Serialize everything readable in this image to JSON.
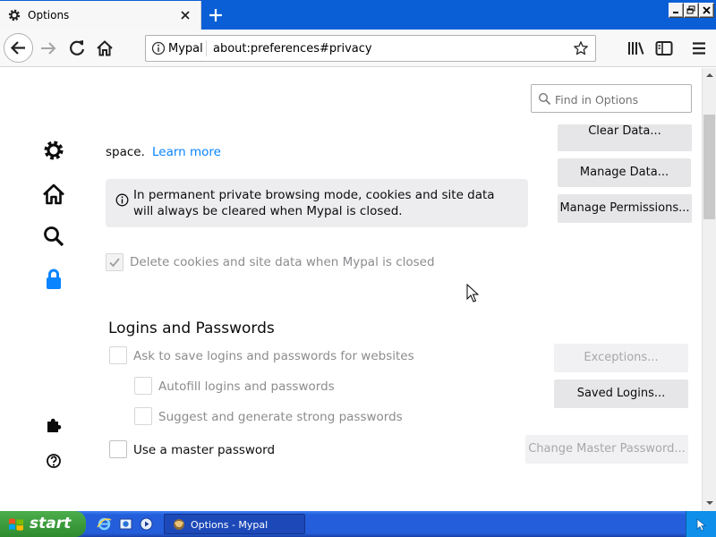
{
  "window": {
    "tab_title": "Options",
    "colors": {
      "titlebar": "#0a5fd6",
      "accent_link": "#0a84ff",
      "taskbar": "#245edb",
      "start_button": "#3c9c3c"
    }
  },
  "urlbar": {
    "identity_label": "Mypal",
    "url": "about:preferences#privacy"
  },
  "search": {
    "placeholder": "Find in Options"
  },
  "sidebar": {
    "categories": [
      {
        "icon": "gear-icon",
        "name": "General"
      },
      {
        "icon": "home-icon",
        "name": "Home"
      },
      {
        "icon": "search-icon",
        "name": "Search"
      },
      {
        "icon": "lock-icon",
        "name": "Privacy & Security",
        "selected": true
      }
    ],
    "footer": [
      {
        "icon": "puzzle-icon"
      },
      {
        "icon": "help-icon"
      }
    ]
  },
  "cookies": {
    "text_tail": "space.",
    "learn_more": "Learn more",
    "clear_data_label": "Clear Data...",
    "manage_data_label": "Manage Data...",
    "manage_permissions_label": "Manage Permissions...",
    "info_message": "In permanent private browsing mode, cookies and site data will always be cleared when Mypal is closed.",
    "delete_on_close_label": "Delete cookies and site data when Mypal is closed",
    "delete_on_close_checked": true
  },
  "logins": {
    "heading": "Logins and Passwords",
    "ask_to_save_label": "Ask to save logins and passwords for websites",
    "autofill_label": "Autofill logins and passwords",
    "suggest_label": "Suggest and generate strong passwords",
    "master_password_label": "Use a master password",
    "exceptions_label": "Exceptions...",
    "saved_logins_label": "Saved Logins...",
    "change_master_label": "Change Master Password..."
  },
  "taskbar": {
    "start_label": "start",
    "task_label": "Options - Mypal"
  }
}
